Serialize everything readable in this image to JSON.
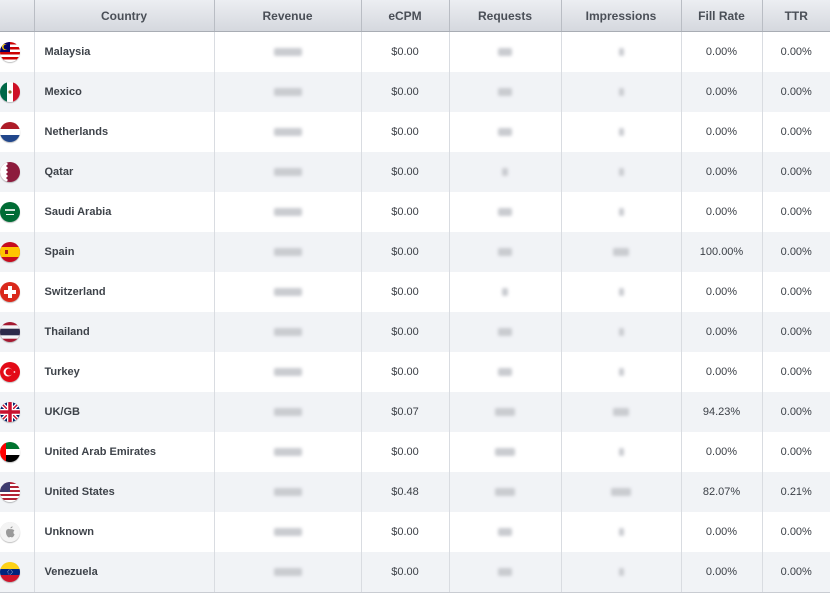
{
  "columns": [
    "",
    "Country",
    "Revenue",
    "eCPM",
    "Requests",
    "Impressions",
    "Fill Rate",
    "TTR"
  ],
  "rows": [
    {
      "country": "Malaysia",
      "flag": "flag-malaysia",
      "ecpm": "$0.00",
      "fill_rate": "0.00%",
      "ttr": "0.00%"
    },
    {
      "country": "Mexico",
      "flag": "flag-mexico",
      "ecpm": "$0.00",
      "fill_rate": "0.00%",
      "ttr": "0.00%"
    },
    {
      "country": "Netherlands",
      "flag": "flag-netherlands",
      "ecpm": "$0.00",
      "fill_rate": "0.00%",
      "ttr": "0.00%"
    },
    {
      "country": "Qatar",
      "flag": "flag-qatar",
      "ecpm": "$0.00",
      "fill_rate": "0.00%",
      "ttr": "0.00%"
    },
    {
      "country": "Saudi Arabia",
      "flag": "flag-saudi-arabia",
      "ecpm": "$0.00",
      "fill_rate": "0.00%",
      "ttr": "0.00%"
    },
    {
      "country": "Spain",
      "flag": "flag-spain",
      "ecpm": "$0.00",
      "fill_rate": "100.00%",
      "ttr": "0.00%"
    },
    {
      "country": "Switzerland",
      "flag": "flag-switzerland",
      "ecpm": "$0.00",
      "fill_rate": "0.00%",
      "ttr": "0.00%"
    },
    {
      "country": "Thailand",
      "flag": "flag-thailand",
      "ecpm": "$0.00",
      "fill_rate": "0.00%",
      "ttr": "0.00%"
    },
    {
      "country": "Turkey",
      "flag": "flag-turkey",
      "ecpm": "$0.00",
      "fill_rate": "0.00%",
      "ttr": "0.00%"
    },
    {
      "country": "UK/GB",
      "flag": "flag-uk",
      "ecpm": "$0.07",
      "fill_rate": "94.23%",
      "ttr": "0.00%"
    },
    {
      "country": "United Arab Emirates",
      "flag": "flag-uae",
      "ecpm": "$0.00",
      "fill_rate": "0.00%",
      "ttr": "0.00%"
    },
    {
      "country": "United States",
      "flag": "flag-united-states",
      "ecpm": "$0.48",
      "fill_rate": "82.07%",
      "ttr": "0.21%"
    },
    {
      "country": "Unknown",
      "flag": "apple-icon",
      "ecpm": "$0.00",
      "fill_rate": "0.00%",
      "ttr": "0.00%"
    },
    {
      "country": "Venezuela",
      "flag": "flag-venezuela",
      "ecpm": "$0.00",
      "fill_rate": "0.00%",
      "ttr": "0.00%"
    }
  ],
  "colors": {
    "header_top": "#eceef2",
    "header_bottom": "#d5d8de",
    "row_alt": "#f1f3f6",
    "text": "#3b3f46"
  }
}
